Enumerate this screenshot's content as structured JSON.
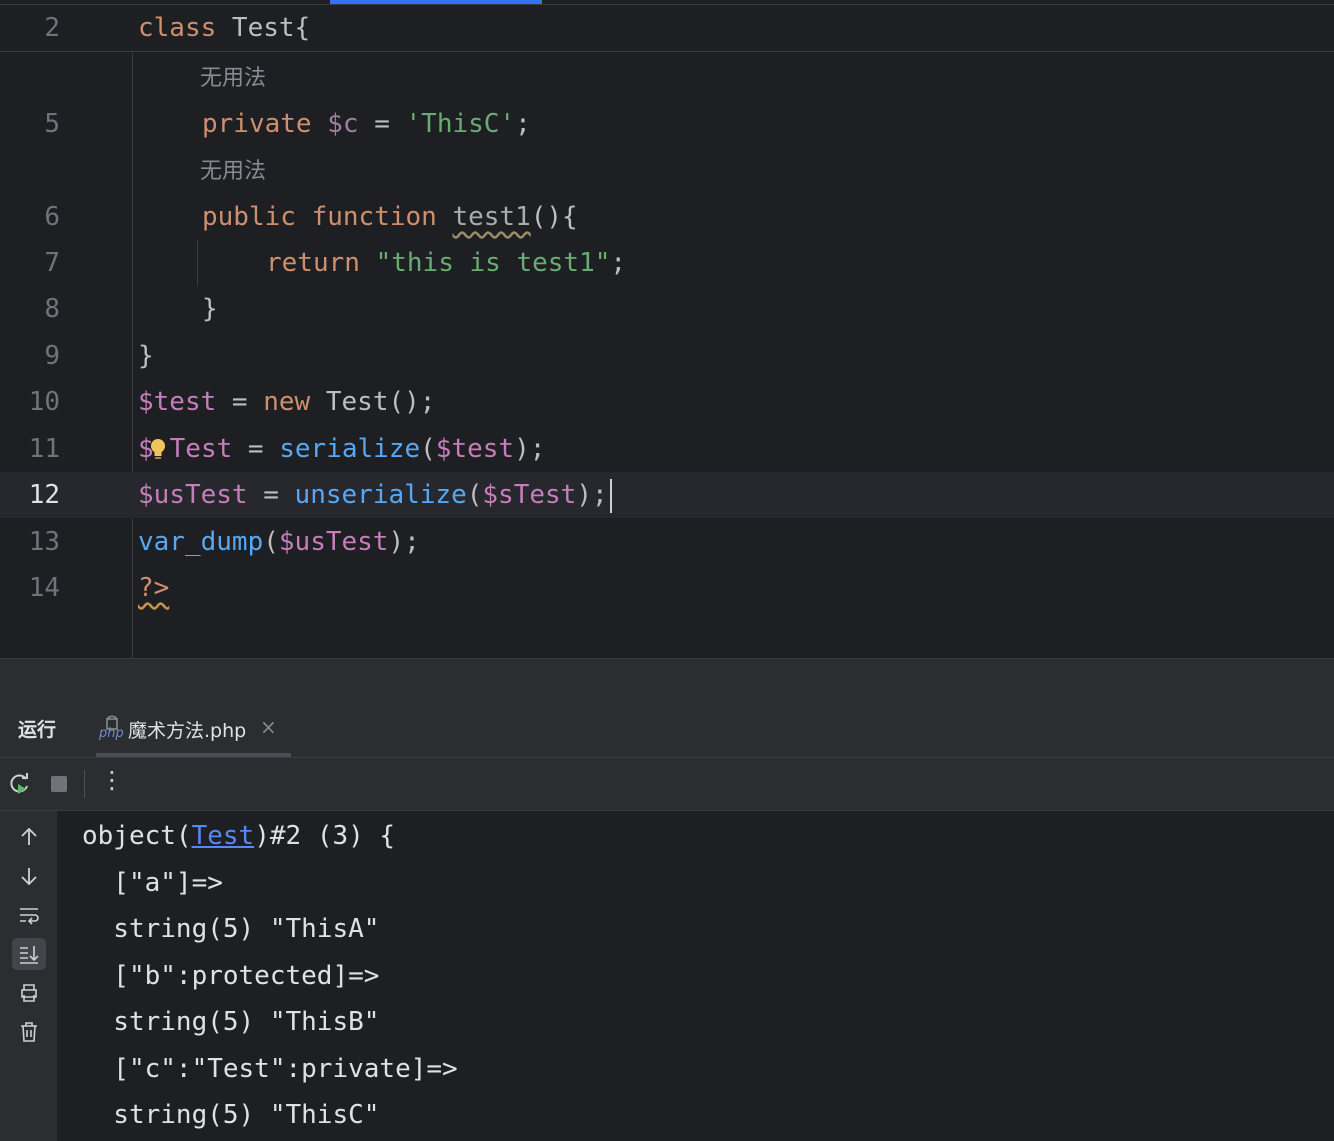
{
  "editor": {
    "sticky_line": {
      "number": "2",
      "keyword": "class",
      "rest": " Test{"
    },
    "hints": [
      "无用法",
      "无用法"
    ],
    "lines": [
      {
        "number": "5",
        "keyword": "private",
        "var": " $c",
        "op": " = ",
        "string": "'ThisC'",
        "end": ";"
      },
      {
        "number": "6",
        "kw1": "public",
        "kw2": "function",
        "name": "test1",
        "end": "(){"
      },
      {
        "number": "7",
        "keyword": "return",
        "string": "\"this is test1\"",
        "end": ";"
      },
      {
        "number": "8",
        "text": "}"
      },
      {
        "number": "9",
        "text": "}"
      },
      {
        "number": "10",
        "var": "$test",
        "op": " = ",
        "keyword": "new",
        "rest": " Test();"
      },
      {
        "number": "11",
        "var_a": "$",
        "var_b": "Test",
        "op": " = ",
        "fn": "serialize",
        "open": "(",
        "arg": "$test",
        "end": ");"
      },
      {
        "number": "12",
        "var": "$usTest",
        "op": " = ",
        "fn": "unserialize",
        "open": "(",
        "arg": "$sTest",
        "end": ");"
      },
      {
        "number": "13",
        "fn": "var_dump",
        "open": "(",
        "arg": "$usTest",
        "end": ");"
      },
      {
        "number": "14",
        "text": "?>"
      }
    ]
  },
  "run_panel": {
    "title": "运行",
    "tab_icon_label": "php",
    "tab_label": "魔术方法.php",
    "tab_close": "×",
    "toolbar": {
      "rerun": "rerun-icon",
      "stop": "stop-icon",
      "more": "⋮"
    },
    "side_icons": [
      "arrow-up-icon",
      "arrow-down-icon",
      "soft-wrap-icon",
      "scroll-to-end-icon",
      "print-icon",
      "trash-icon"
    ],
    "output": {
      "line0_a": "object(",
      "line0_link": "Test",
      "line0_b": ")#2 (3) {",
      "lines": [
        "  [\"a\"]=>",
        "  string(5) \"ThisA\"",
        "  [\"b\":protected]=>",
        "  string(5) \"ThisB\"",
        "  [\"c\":\"Test\":private]=>",
        "  string(5) \"ThisC\""
      ]
    }
  },
  "colors": {
    "background": "#1e1f22",
    "panel": "#2b2d30",
    "keyword": "#cf8e6d",
    "variable": "#c77dbb",
    "string": "#6aab73",
    "function": "#56a8f5",
    "accent": "#3574f0"
  }
}
